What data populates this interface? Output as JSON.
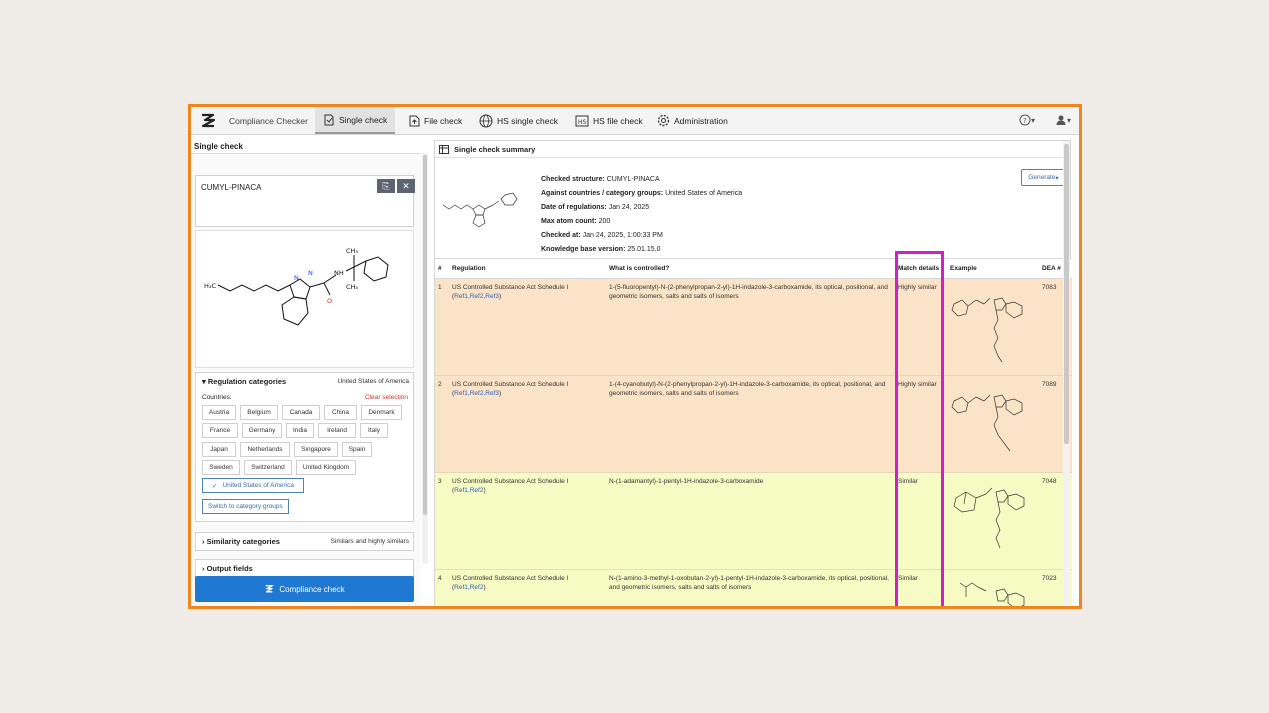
{
  "app": {
    "title": "Compliance Checker"
  },
  "nav": {
    "tabs": [
      {
        "label": "Single check",
        "icon": "single-check-icon"
      },
      {
        "label": "File check",
        "icon": "file-upload-icon"
      },
      {
        "label": "HS single check",
        "icon": "hs-globe-icon"
      },
      {
        "label": "HS file check",
        "icon": "hs-file-icon"
      },
      {
        "label": "Administration",
        "icon": "gear-icon"
      }
    ],
    "help_icon": "help-icon",
    "user_icon": "user-icon"
  },
  "left": {
    "title": "Single check",
    "structure_name": "CUMYL-PINACA",
    "regulation": {
      "header": "Regulation categories",
      "selected_summary": "United States of America",
      "countries_label": "Countries:",
      "clear_label": "Clear selection",
      "countries": [
        "Austria",
        "Belgium",
        "Canada",
        "China",
        "Denmark",
        "France",
        "Germany",
        "India",
        "Ireland",
        "Italy",
        "Japan",
        "Netherlands",
        "Singapore",
        "Spain",
        "Sweden",
        "Switzerland",
        "United Kingdom",
        "United States of America"
      ],
      "selected": "United States of America",
      "switch_label": "Switch to category groups"
    },
    "similarity": {
      "header": "Similarity categories",
      "summary": "Similars and highly similars"
    },
    "output": {
      "header": "Output fields"
    },
    "check_button": "Compliance check"
  },
  "summary": {
    "title": "Single check summary",
    "generate": "Generate",
    "rows": [
      {
        "label": "Checked structure:",
        "value": "CUMYL-PINACA"
      },
      {
        "label": "Against countries / category groups:",
        "value": "United States of America"
      },
      {
        "label": "Date of regulations:",
        "value": "Jan 24, 2025"
      },
      {
        "label": "Max atom count:",
        "value": "200"
      },
      {
        "label": "Checked at:",
        "value": "Jan 24, 2025, 1:00:33 PM"
      },
      {
        "label": "Knowledge base version:",
        "value": "25.01.15.0"
      }
    ]
  },
  "table": {
    "headers": {
      "num": "#",
      "regulation": "Regulation",
      "what": "What is controlled?",
      "match": "Match details",
      "example": "Example",
      "dea": "DEA #"
    },
    "rows": [
      {
        "num": "1",
        "regulation": "US Controlled Substance Act Schedule I",
        "refs": "Ref1,Ref2,Ref3",
        "what": "1-(5-fluoropentyl)-N-(2-phenylpropan-2-yl)-1H-indazole-3-carboxamide, its optical, positional, and geometric isomers, salts and salts of isomers",
        "match": "Highly similar",
        "dea": "7083",
        "color": "orange"
      },
      {
        "num": "2",
        "regulation": "US Controlled Substance Act Schedule I",
        "refs": "Ref1,Ref2,Ref3",
        "what": "1-(4-cyanobutyl)-N-(2-phenylpropan-2-yl)-1H-indazole-3-carboxamide, its optical, positional, and geometric isomers, salts and salts of isomers",
        "match": "Highly similar",
        "dea": "7089",
        "color": "orange"
      },
      {
        "num": "3",
        "regulation": "US Controlled Substance Act Schedule I",
        "refs": "Ref1,Ref2",
        "what": "N-(1-adamantyl)-1-pentyl-1H-indazole-3-carboxamide",
        "match": "Similar",
        "dea": "7048",
        "color": "yellow"
      },
      {
        "num": "4",
        "regulation": "US Controlled Substance Act Schedule I",
        "refs": "Ref1,Ref2",
        "what": "N-(1-amino-3-methyl-1-oxobutan-2-yl)-1-pentyl-1H-indazole-3-carboxamide, its optical, positional, and geometric isomers, salts and salts of isomers",
        "match": "Similar",
        "dea": "7023",
        "color": "yellow"
      }
    ]
  }
}
